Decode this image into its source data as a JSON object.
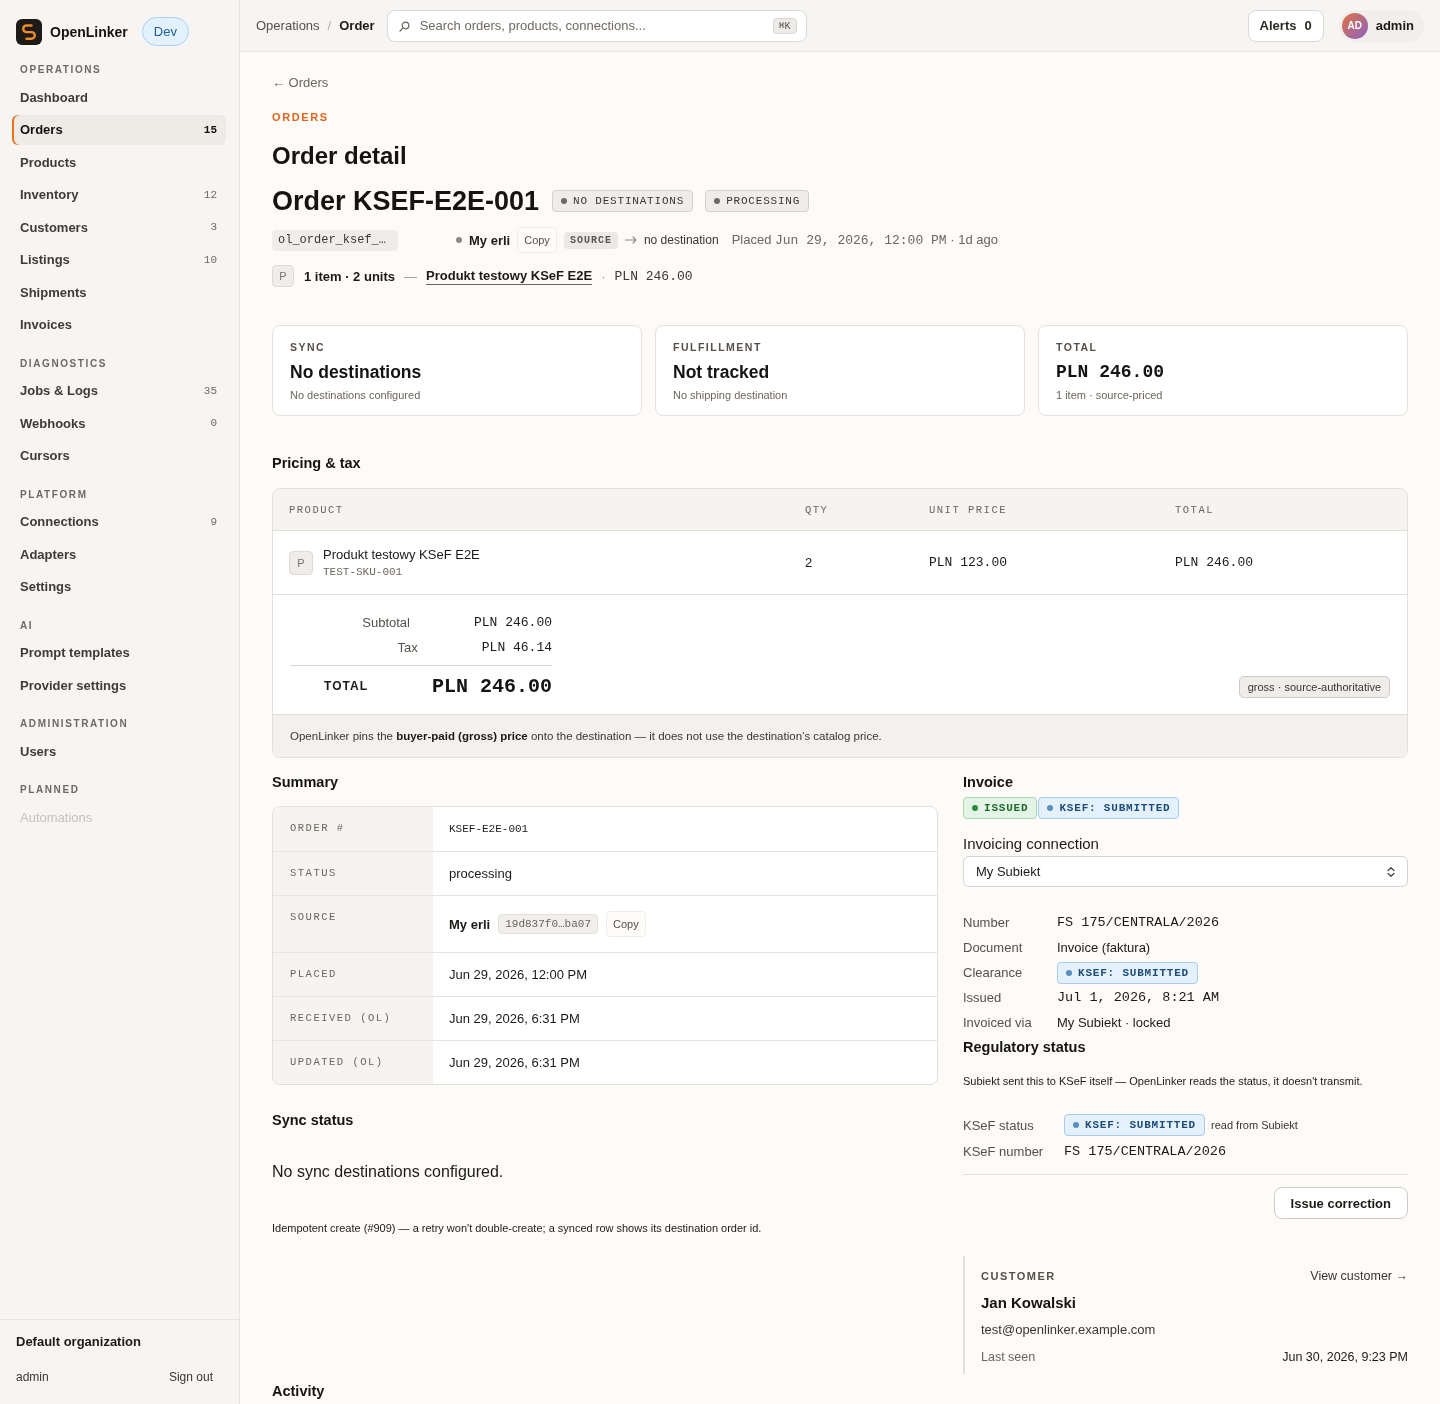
{
  "sidebar": {
    "brand": {
      "name": "OpenLinker",
      "env": "Dev"
    },
    "sections": [
      {
        "title": "OPERATIONS",
        "items": [
          {
            "label": "Dashboard",
            "selected": false,
            "disabled": false
          },
          {
            "label": "Orders",
            "count": "15",
            "selected": true,
            "disabled": false
          },
          {
            "label": "Products",
            "selected": false,
            "disabled": false
          },
          {
            "label": "Inventory",
            "count": "12",
            "selected": false,
            "disabled": false
          },
          {
            "label": "Customers",
            "count": "3",
            "selected": false,
            "disabled": false
          },
          {
            "label": "Listings",
            "count": "10",
            "selected": false,
            "disabled": false
          },
          {
            "label": "Shipments",
            "selected": false,
            "disabled": false
          },
          {
            "label": "Invoices",
            "selected": false,
            "disabled": false
          }
        ]
      },
      {
        "title": "DIAGNOSTICS",
        "items": [
          {
            "label": "Jobs & Logs",
            "count": "35",
            "selected": false,
            "disabled": false
          },
          {
            "label": "Webhooks",
            "count": "0",
            "selected": false,
            "disabled": false
          },
          {
            "label": "Cursors",
            "selected": false,
            "disabled": false
          }
        ]
      },
      {
        "title": "PLATFORM",
        "items": [
          {
            "label": "Connections",
            "count": "9",
            "selected": false,
            "disabled": false
          },
          {
            "label": "Adapters",
            "selected": false,
            "disabled": false
          },
          {
            "label": "Settings",
            "selected": false,
            "disabled": false
          }
        ]
      },
      {
        "title": "AI",
        "items": [
          {
            "label": "Prompt templates",
            "selected": false,
            "disabled": false
          },
          {
            "label": "Provider settings",
            "selected": false,
            "disabled": false
          }
        ]
      },
      {
        "title": "ADMINISTRATION",
        "items": [
          {
            "label": "Users",
            "selected": false,
            "disabled": false
          }
        ]
      },
      {
        "title": "PLANNED",
        "items": [
          {
            "label": "Automations",
            "selected": false,
            "disabled": true
          }
        ]
      }
    ],
    "footer": {
      "organization": "Default organization",
      "user": "admin",
      "sign_out": "Sign out"
    }
  },
  "header": {
    "breadcrumb": {
      "parent": "Operations",
      "separator": "/",
      "current": "Order"
    },
    "search": {
      "placeholder": "Search orders, products, connections...",
      "shortcut": "⌘K"
    },
    "alerts": {
      "label": "Alerts",
      "count": "0"
    },
    "user": {
      "initials": "AD",
      "name": "admin"
    }
  },
  "page": {
    "back": "← Orders",
    "eyebrow": "ORDERS",
    "title": "Order detail",
    "order_title": "Order KSEF-E2E-001",
    "badges": [
      {
        "label": "NO DESTINATIONS",
        "kind": "neutral"
      },
      {
        "label": "PROCESSING",
        "kind": "neutral"
      }
    ],
    "meta": {
      "id": "ol_order_ksef_…",
      "source": "My erli",
      "copy": "Copy",
      "source_tag": "SOURCE",
      "destination": "no destination",
      "placed": {
        "label": "Placed",
        "time": "Jun 29, 2026, 12:00 PM",
        "ago": "· 1d ago"
      }
    },
    "items_line": {
      "thumb": "P",
      "summary": "1 item · 2 units",
      "dash": "—",
      "product": "Produkt testowy KSeF E2E",
      "dot": "·",
      "amount": "PLN 246.00"
    }
  },
  "cards": [
    {
      "label": "SYNC",
      "value": "No destinations",
      "sub": "No destinations configured",
      "kind": "text"
    },
    {
      "label": "FULFILLMENT",
      "value": "Not tracked",
      "sub": "No shipping destination",
      "kind": "text"
    },
    {
      "label": "TOTAL",
      "value": "PLN 246.00",
      "sub": "1 item · source-priced",
      "kind": "money"
    }
  ],
  "pricing": {
    "title": "Pricing & tax",
    "columns": [
      "PRODUCT",
      "QTY",
      "UNIT PRICE",
      "TOTAL"
    ],
    "rows": [
      {
        "thumb": "P",
        "name": "Produkt testowy KSeF E2E",
        "sku": "TEST-SKU-001",
        "qty": "2",
        "unit_price": "PLN 123.00",
        "total": "PLN 246.00"
      }
    ],
    "subtotal": {
      "label": "Subtotal",
      "value": "PLN 246.00"
    },
    "tax": {
      "label": "Tax",
      "value": "PLN 46.14"
    },
    "total": {
      "label": "TOTAL",
      "value": "PLN 246.00"
    },
    "basis": "gross · source-authoritative",
    "note": "OpenLinker pins the **buyer-paid (gross) price** onto the destination — it does not use the destination’s catalog price."
  },
  "summary": {
    "title": "Summary",
    "rows": [
      {
        "label": "ORDER #",
        "kind": "mono",
        "value": "KSEF-E2E-001"
      },
      {
        "label": "STATUS",
        "kind": "text",
        "value": "processing"
      },
      {
        "label": "SOURCE",
        "kind": "source",
        "value": "My erli",
        "chip": "19d837f0…ba07",
        "action": "Copy"
      },
      {
        "label": "PLACED",
        "kind": "text",
        "value": "Jun 29, 2026, 12:00 PM"
      },
      {
        "label": "RECEIVED (OL)",
        "kind": "text",
        "value": "Jun 29, 2026, 6:31 PM"
      },
      {
        "label": "UPDATED (OL)",
        "kind": "text",
        "value": "Jun 29, 2026, 6:31 PM"
      }
    ]
  },
  "sync": {
    "title": "Sync status",
    "empty": "No sync destinations configured.",
    "note": "Idempotent create (#909) — a retry won't double-create; a synced row shows its destination order id."
  },
  "invoice": {
    "title": "Invoice",
    "badges": [
      {
        "label": "ISSUED",
        "kind": "success"
      },
      {
        "label": "KSEF: SUBMITTED",
        "kind": "info"
      }
    ],
    "connection": {
      "label": "Invoicing connection",
      "value": "My Subiekt"
    },
    "details": [
      {
        "label": "Number",
        "kind": "mono",
        "value": "FS 175/CENTRALA/2026"
      },
      {
        "label": "Document",
        "kind": "text",
        "value": "Invoice (faktura)"
      },
      {
        "label": "Clearance",
        "kind": "badge",
        "badge": {
          "label": "KSEF: SUBMITTED",
          "kind": "info"
        }
      },
      {
        "label": "Issued",
        "kind": "mono",
        "value": "Jul 1, 2026, 8:21 AM"
      },
      {
        "label": "Invoiced via",
        "kind": "text",
        "value": "My Subiekt · locked"
      }
    ],
    "regulatory": {
      "title": "Regulatory status",
      "note": "Subiekt sent this to KSeF itself — OpenLinker reads the status, it doesn't transmit.",
      "rows": [
        {
          "label": "KSeF status",
          "kind": "badge",
          "badge": {
            "label": "KSEF: SUBMITTED",
            "kind": "info"
          },
          "hint": "read from Subiekt"
        },
        {
          "label": "KSeF number",
          "kind": "mono",
          "value": "FS 175/CENTRALA/2026"
        }
      ]
    },
    "action": "Issue correction"
  },
  "customer": {
    "label": "CUSTOMER",
    "link": "View customer →",
    "name": "Jan Kowalski",
    "email": "test@openlinker.example.com",
    "last_seen_label": "Last seen",
    "last_seen": "Jun 30, 2026, 9:23 PM"
  },
  "activity": {
    "title": "Activity"
  }
}
